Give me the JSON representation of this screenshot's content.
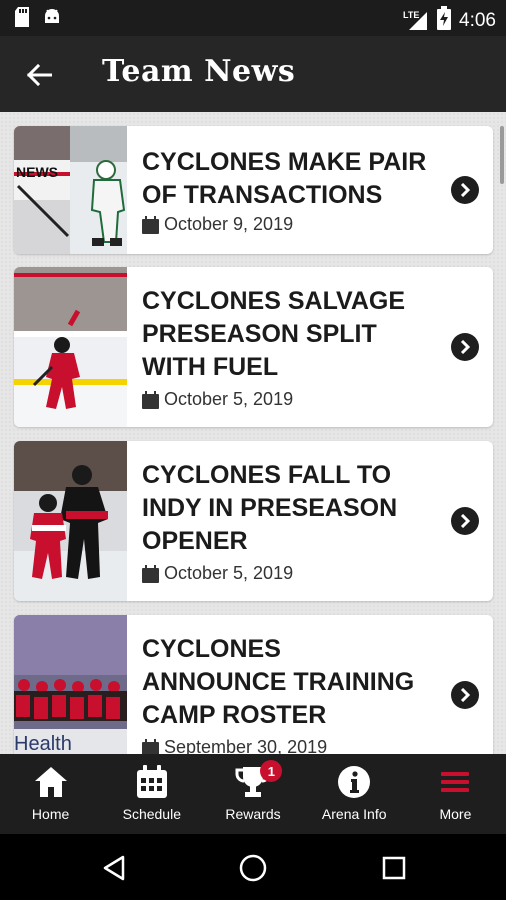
{
  "status_bar": {
    "time": "4:06",
    "network": "LTE"
  },
  "header": {
    "title": "Team News"
  },
  "articles": [
    {
      "title_lines": [
        "CYCLONES MAKE PAIR",
        "OF TRANSACTIONS"
      ],
      "date": "October 9, 2019"
    },
    {
      "title_lines": [
        "CYCLONES SALVAGE",
        "PRESEASON SPLIT",
        "WITH FUEL"
      ],
      "date": "October 5, 2019"
    },
    {
      "title_lines": [
        "CYCLONES FALL TO",
        "INDY IN PRESEASON",
        "OPENER"
      ],
      "date": "October 5, 2019"
    },
    {
      "title_lines": [
        "CYCLONES",
        "ANNOUNCE TRAINING",
        "CAMP ROSTER"
      ],
      "date": "September 30, 2019"
    }
  ],
  "thumb_text": {
    "news": "NEWS",
    "health": "Health"
  },
  "bottom_nav": [
    {
      "label": "Home",
      "icon": "home-icon"
    },
    {
      "label": "Schedule",
      "icon": "calendar-icon"
    },
    {
      "label": "Rewards",
      "icon": "trophy-icon",
      "badge": "1"
    },
    {
      "label": "Arena Info",
      "icon": "info-icon"
    },
    {
      "label": "More",
      "icon": "menu-icon",
      "active": true
    }
  ],
  "colors": {
    "accent": "#c8102e",
    "header": "#262626",
    "nav": "#1e1e1e"
  }
}
